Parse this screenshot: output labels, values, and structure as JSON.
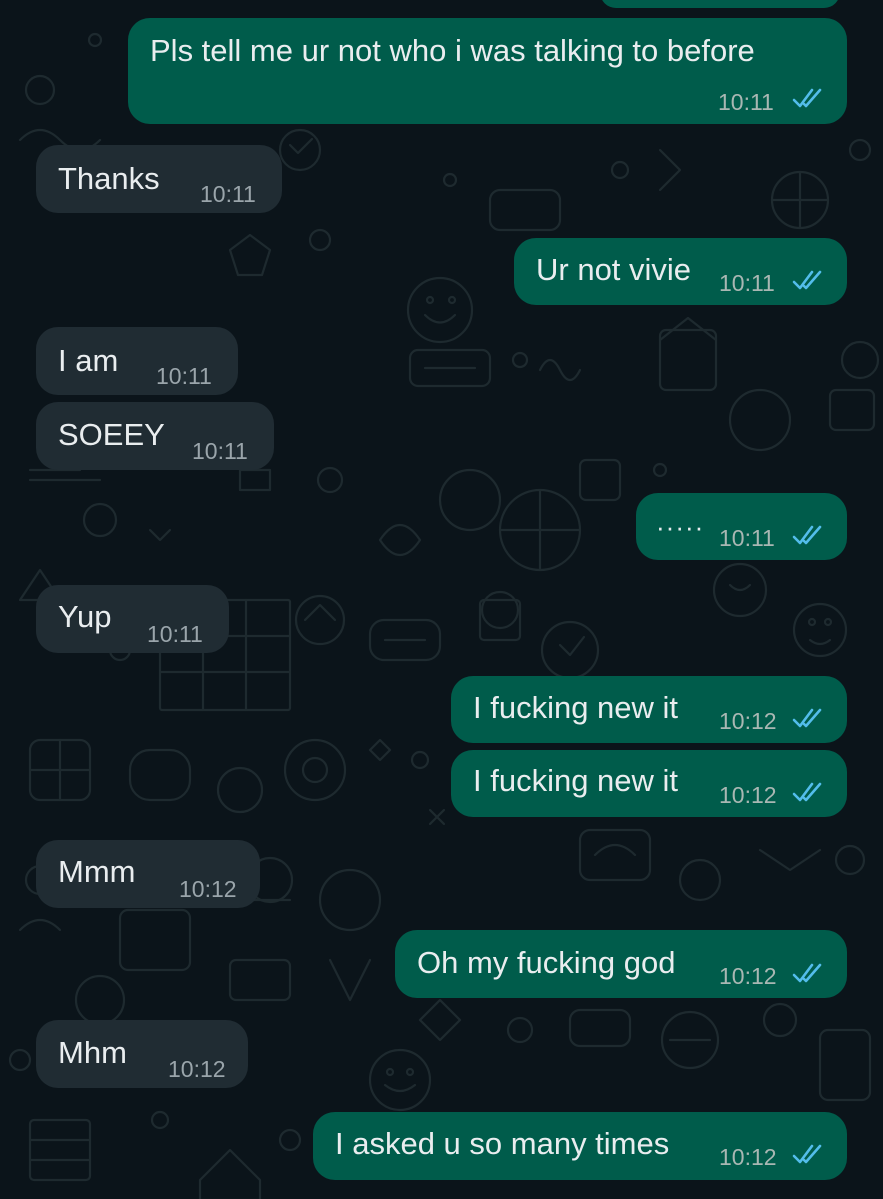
{
  "colors": {
    "background": "#0b141a",
    "incoming_bubble": "#202c33",
    "outgoing_bubble": "#005c4b",
    "read_ticks": "#53bdeb",
    "text": "#e9edef"
  },
  "messages": [
    {
      "direction": "outgoing",
      "text": "Pls tell me ur not who i was talking to before",
      "time": "10:11",
      "status": "read"
    },
    {
      "direction": "incoming",
      "text": "Thanks",
      "time": "10:11"
    },
    {
      "direction": "outgoing",
      "text": "Ur not vivie",
      "time": "10:11",
      "status": "read"
    },
    {
      "direction": "incoming",
      "text": "I am",
      "time": "10:11"
    },
    {
      "direction": "incoming",
      "text": "SOEEY",
      "time": "10:11"
    },
    {
      "direction": "outgoing",
      "text": "·····",
      "time": "10:11",
      "status": "read"
    },
    {
      "direction": "incoming",
      "text": "Yup",
      "time": "10:11"
    },
    {
      "direction": "outgoing",
      "text": "I fucking new it",
      "time": "10:12",
      "status": "read"
    },
    {
      "direction": "outgoing",
      "text": "I fucking new it",
      "time": "10:12",
      "status": "read"
    },
    {
      "direction": "incoming",
      "text": "Mmm",
      "time": "10:12"
    },
    {
      "direction": "outgoing",
      "text": "Oh my fucking god",
      "time": "10:12",
      "status": "read"
    },
    {
      "direction": "incoming",
      "text": "Mhm",
      "time": "10:12"
    },
    {
      "direction": "outgoing",
      "text": "I asked u so many times",
      "time": "10:12",
      "status": "read"
    }
  ]
}
